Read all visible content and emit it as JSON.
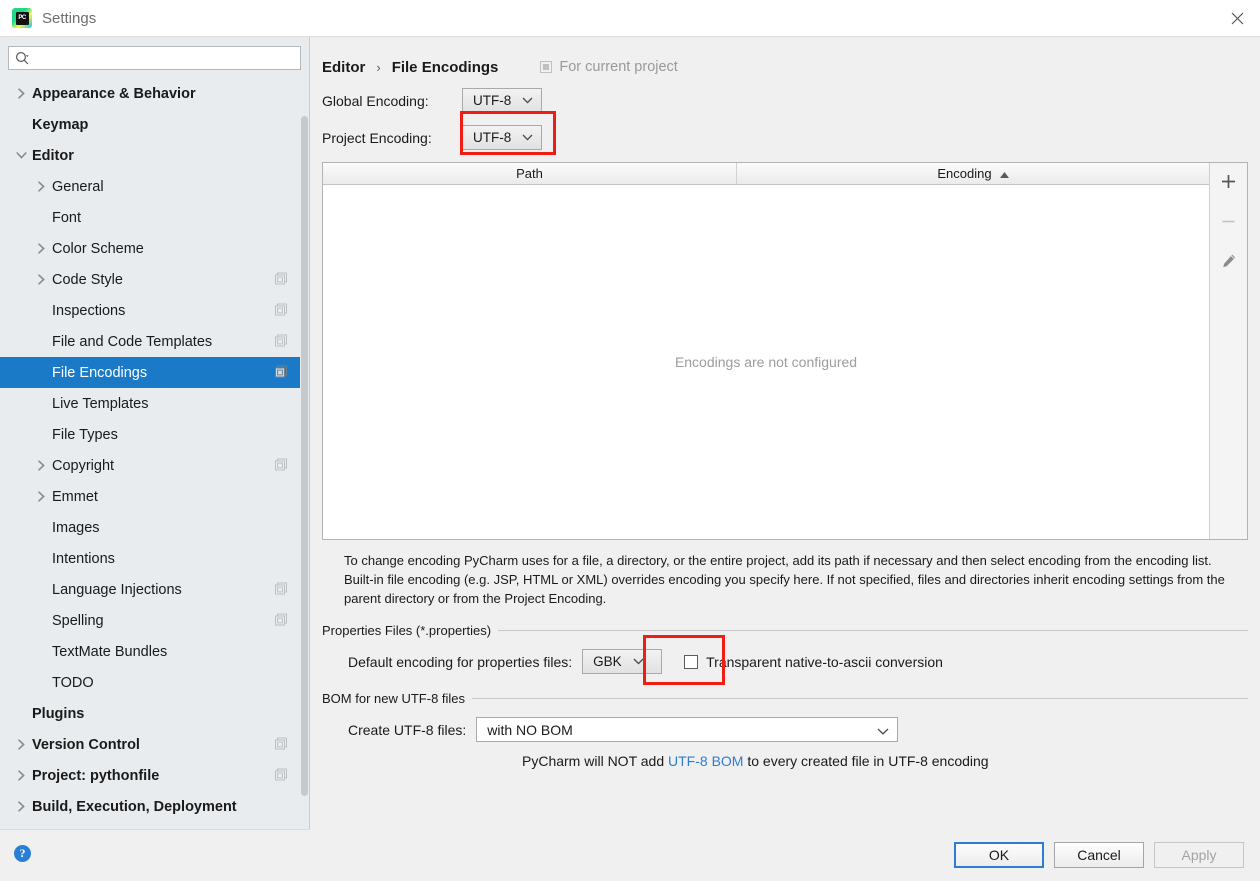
{
  "window": {
    "title": "Settings",
    "logo_text": "PC",
    "close_icon": "close-icon"
  },
  "sidebar": {
    "search": {
      "placeholder": "",
      "value": "",
      "icon": "search-icon"
    },
    "items": [
      {
        "label": "Appearance & Behavior",
        "level": 0,
        "arrow": "right",
        "scope_icon": false,
        "selected": false
      },
      {
        "label": "Keymap",
        "level": 0,
        "arrow": "none",
        "scope_icon": false,
        "selected": false
      },
      {
        "label": "Editor",
        "level": 0,
        "arrow": "down",
        "scope_icon": false,
        "selected": false
      },
      {
        "label": "General",
        "level": 1,
        "arrow": "right",
        "scope_icon": false,
        "selected": false
      },
      {
        "label": "Font",
        "level": 1,
        "arrow": "none",
        "scope_icon": false,
        "selected": false
      },
      {
        "label": "Color Scheme",
        "level": 1,
        "arrow": "right",
        "scope_icon": false,
        "selected": false
      },
      {
        "label": "Code Style",
        "level": 1,
        "arrow": "right",
        "scope_icon": true,
        "selected": false
      },
      {
        "label": "Inspections",
        "level": 1,
        "arrow": "none",
        "scope_icon": true,
        "selected": false
      },
      {
        "label": "File and Code Templates",
        "level": 1,
        "arrow": "none",
        "scope_icon": true,
        "selected": false
      },
      {
        "label": "File Encodings",
        "level": 1,
        "arrow": "none",
        "scope_icon": true,
        "selected": true
      },
      {
        "label": "Live Templates",
        "level": 1,
        "arrow": "none",
        "scope_icon": false,
        "selected": false
      },
      {
        "label": "File Types",
        "level": 1,
        "arrow": "none",
        "scope_icon": false,
        "selected": false
      },
      {
        "label": "Copyright",
        "level": 1,
        "arrow": "right",
        "scope_icon": true,
        "selected": false
      },
      {
        "label": "Emmet",
        "level": 1,
        "arrow": "right",
        "scope_icon": false,
        "selected": false
      },
      {
        "label": "Images",
        "level": 1,
        "arrow": "none",
        "scope_icon": false,
        "selected": false
      },
      {
        "label": "Intentions",
        "level": 1,
        "arrow": "none",
        "scope_icon": false,
        "selected": false
      },
      {
        "label": "Language Injections",
        "level": 1,
        "arrow": "none",
        "scope_icon": true,
        "selected": false
      },
      {
        "label": "Spelling",
        "level": 1,
        "arrow": "none",
        "scope_icon": true,
        "selected": false
      },
      {
        "label": "TextMate Bundles",
        "level": 1,
        "arrow": "none",
        "scope_icon": false,
        "selected": false
      },
      {
        "label": "TODO",
        "level": 1,
        "arrow": "none",
        "scope_icon": false,
        "selected": false
      },
      {
        "label": "Plugins",
        "level": 0,
        "arrow": "none",
        "scope_icon": false,
        "selected": false
      },
      {
        "label": "Version Control",
        "level": 0,
        "arrow": "right",
        "scope_icon": true,
        "selected": false
      },
      {
        "label": "Project: pythonfile",
        "level": 0,
        "arrow": "right",
        "scope_icon": true,
        "selected": false
      },
      {
        "label": "Build, Execution, Deployment",
        "level": 0,
        "arrow": "right",
        "scope_icon": false,
        "selected": false
      }
    ],
    "help_icon": "help-icon",
    "help_label": "?"
  },
  "main": {
    "breadcrumb": {
      "root": "Editor",
      "separator": "›",
      "leaf": "File Encodings"
    },
    "for_current_project": "For current project",
    "global_encoding": {
      "label": "Global Encoding:",
      "value": "UTF-8"
    },
    "project_encoding": {
      "label": "Project Encoding:",
      "value": "UTF-8",
      "highlight_color": "#ef1d14"
    },
    "table": {
      "columns": [
        "Path",
        "Encoding"
      ],
      "sort_column": "Encoding",
      "sort_direction": "asc",
      "rows": [],
      "empty_message": "Encodings are not configured",
      "toolbar": {
        "add": "+",
        "remove": "−",
        "edit": "edit-pencil"
      }
    },
    "description": "To change encoding PyCharm uses for a file, a directory, or the entire project, add its path if necessary and then select encoding from the encoding list. Built-in file encoding (e.g. JSP, HTML or XML) overrides encoding you specify here. If not specified, files and directories inherit encoding settings from the parent directory or from the Project Encoding.",
    "properties_group": {
      "title": "Properties Files (*.properties)",
      "encoding_label": "Default encoding for properties files:",
      "encoding_value": "GBK",
      "highlight_color": "#ef1d14",
      "checkbox_label": "Transparent native-to-ascii conversion",
      "checkbox_checked": false
    },
    "bom_group": {
      "title": "BOM for new UTF-8 files",
      "create_label": "Create UTF-8 files:",
      "create_value": "with NO BOM",
      "note_prefix": "PyCharm will NOT add ",
      "note_link": "UTF-8 BOM",
      "note_suffix": " to every created file in UTF-8 encoding",
      "link_color": "#2d7dd2"
    }
  },
  "footer": {
    "ok": "OK",
    "cancel": "Cancel",
    "apply": "Apply",
    "apply_disabled": true,
    "focus_color": "#2a7fd4"
  }
}
